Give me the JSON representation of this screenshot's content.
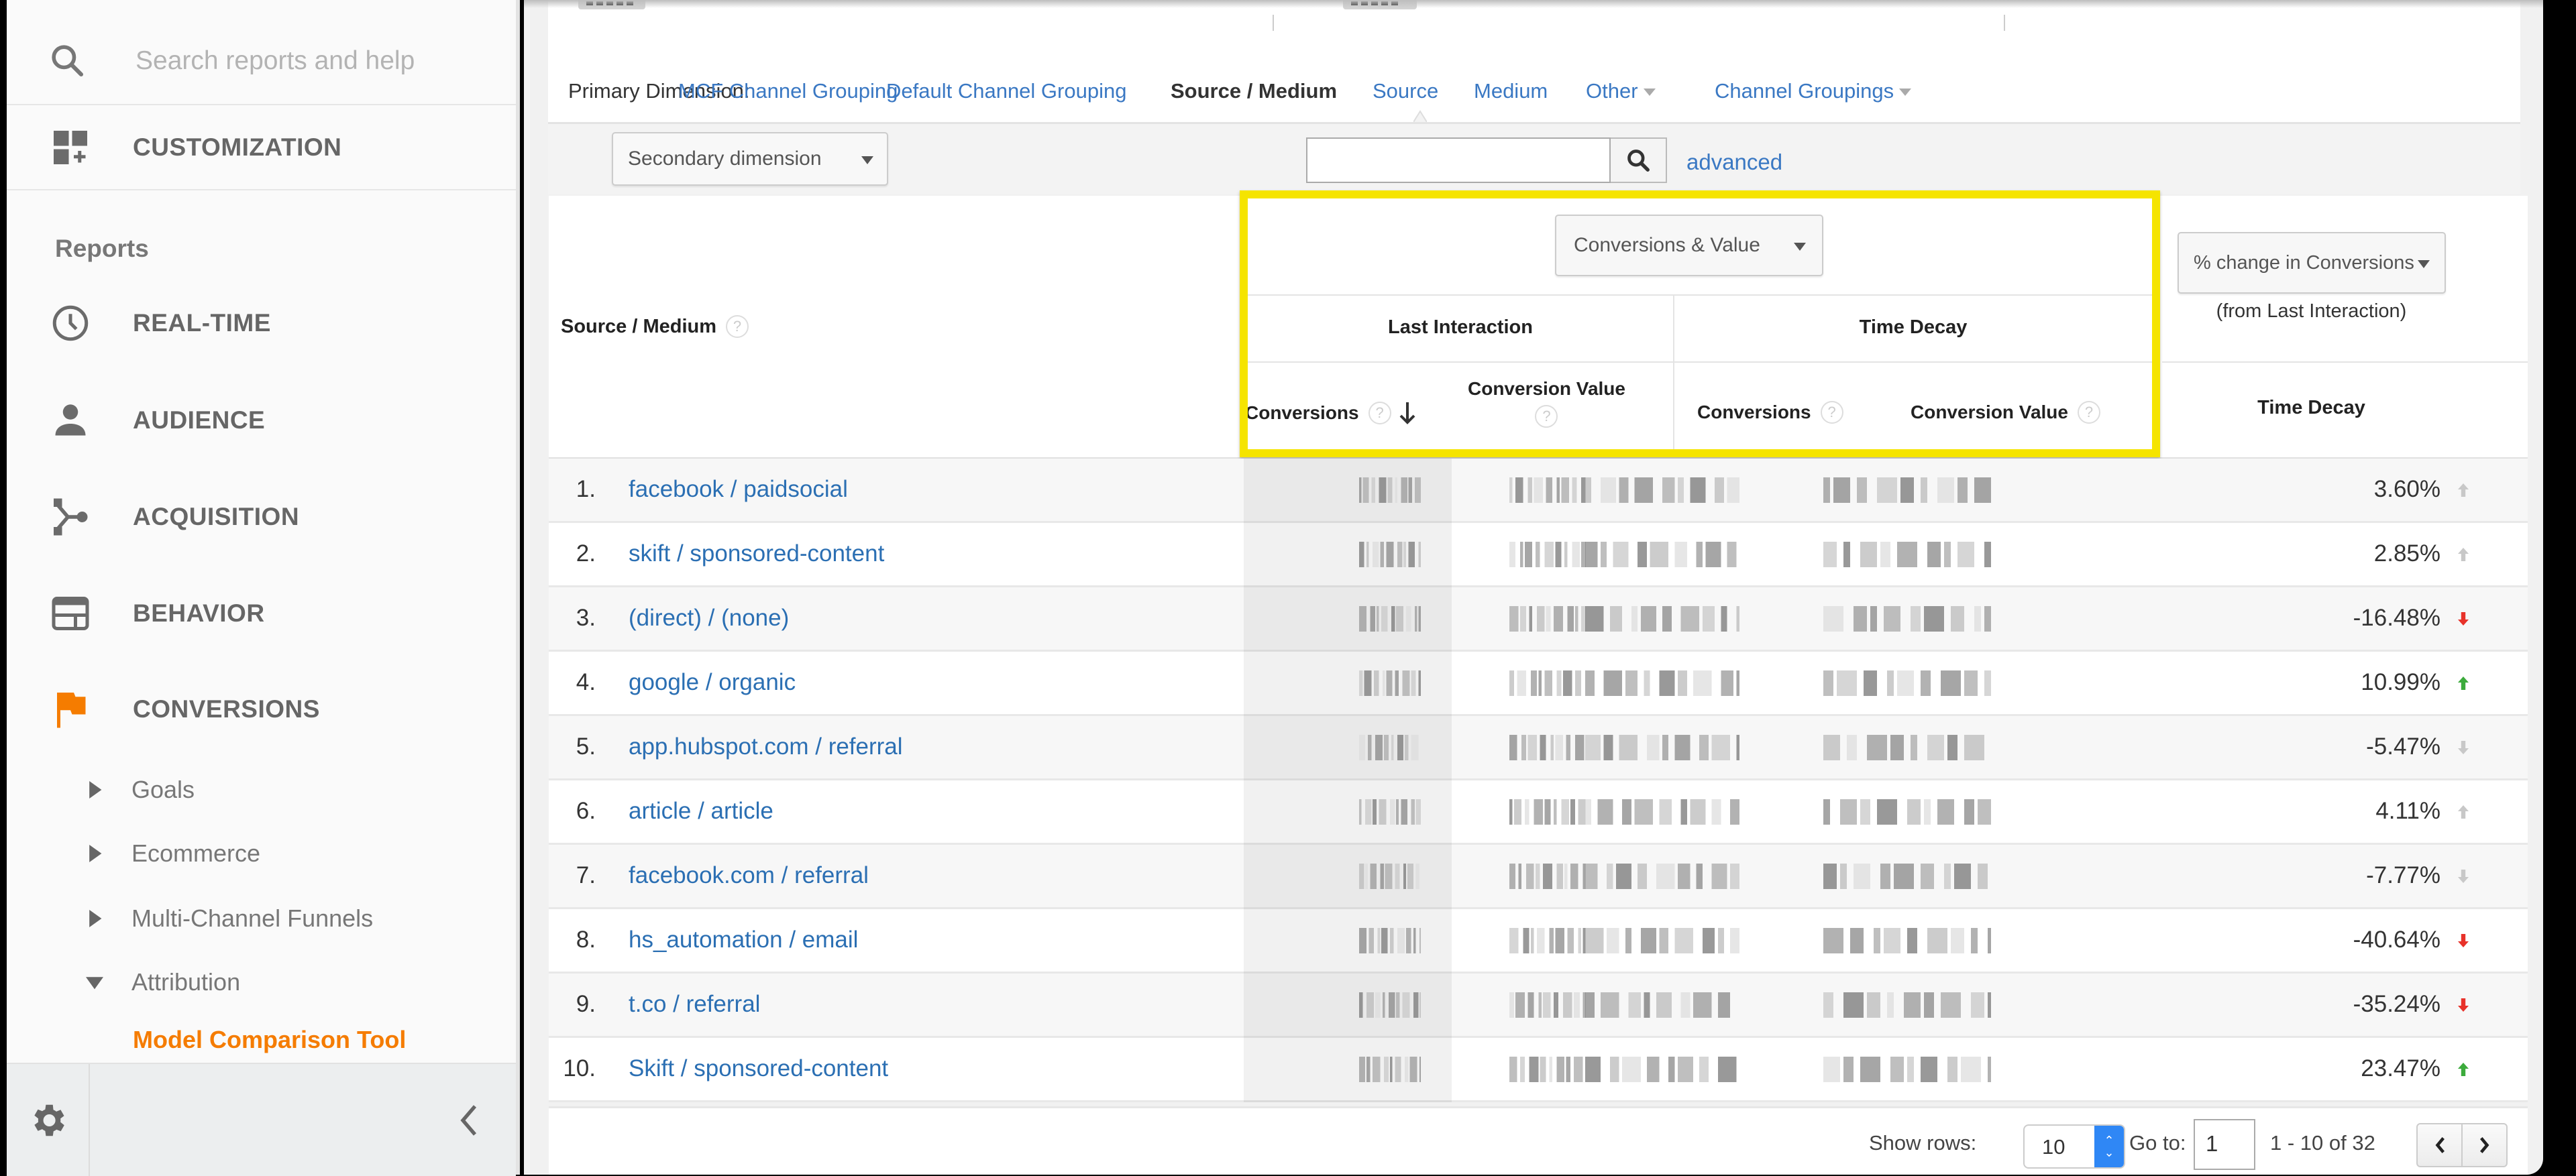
{
  "sidebar": {
    "search_placeholder": "Search reports and help",
    "customization_label": "CUSTOMIZATION",
    "reports_heading": "Reports",
    "nav_items": [
      {
        "label": "REAL-TIME",
        "icon": "clock-icon"
      },
      {
        "label": "AUDIENCE",
        "icon": "person-icon"
      },
      {
        "label": "ACQUISITION",
        "icon": "acquisition-icon"
      },
      {
        "label": "BEHAVIOR",
        "icon": "behavior-icon"
      },
      {
        "label": "CONVERSIONS",
        "icon": "flag-icon",
        "accent": "#f57c00"
      }
    ],
    "sub_items": [
      {
        "label": "Goals",
        "expanded": false
      },
      {
        "label": "Ecommerce",
        "expanded": false
      },
      {
        "label": "Multi-Channel Funnels",
        "expanded": false
      },
      {
        "label": "Attribution",
        "expanded": true
      }
    ],
    "active_item": "Model Comparison Tool"
  },
  "dimension_bar": {
    "label": "Primary Dimension:",
    "options": [
      {
        "label": "MCF Channel Grouping",
        "active": false,
        "dropdown": false
      },
      {
        "label": "Default Channel Grouping",
        "active": false,
        "dropdown": false
      },
      {
        "label": "Source / Medium",
        "active": true,
        "dropdown": false
      },
      {
        "label": "Source",
        "active": false,
        "dropdown": false
      },
      {
        "label": "Medium",
        "active": false,
        "dropdown": false
      },
      {
        "label": "Other",
        "active": false,
        "dropdown": true
      },
      {
        "label": "Channel Groupings",
        "active": false,
        "dropdown": true
      }
    ]
  },
  "toolbar": {
    "secondary_dimension": "Secondary dimension",
    "search_value": "",
    "advanced_label": "advanced"
  },
  "table": {
    "dimension_header": "Source / Medium",
    "metric_selector": "Conversions & Value",
    "model_groups": [
      "Last Interaction",
      "Time Decay"
    ],
    "columns": {
      "li_conversions": "Conversions",
      "li_value": "Conversion Value",
      "td_conversions": "Conversions",
      "td_value": "Conversion Value"
    },
    "sorted_column": "li_conversions",
    "sort_direction": "descending",
    "change_selector": "% change in Conversions",
    "change_sub": "(from Last Interaction)",
    "change_model": "Time Decay",
    "highlight_color": "#f5e400",
    "redacted_note": "numeric cells are pixelated",
    "rows": [
      {
        "num": "1.",
        "source": "facebook / paidsocial",
        "change": "3.60%",
        "trend": "up-neutral"
      },
      {
        "num": "2.",
        "source": "skift / sponsored-content",
        "change": "2.85%",
        "trend": "up-neutral"
      },
      {
        "num": "3.",
        "source": "(direct) / (none)",
        "change": "-16.48%",
        "trend": "down-bad"
      },
      {
        "num": "4.",
        "source": "google / organic",
        "change": "10.99%",
        "trend": "up-good"
      },
      {
        "num": "5.",
        "source": "app.hubspot.com / referral",
        "change": "-5.47%",
        "trend": "down-neutral"
      },
      {
        "num": "6.",
        "source": "article / article",
        "change": "4.11%",
        "trend": "up-neutral"
      },
      {
        "num": "7.",
        "source": "facebook.com / referral",
        "change": "-7.77%",
        "trend": "down-neutral"
      },
      {
        "num": "8.",
        "source": "hs_automation / email",
        "change": "-40.64%",
        "trend": "down-bad"
      },
      {
        "num": "9.",
        "source": "t.co / referral",
        "change": "-35.24%",
        "trend": "down-bad"
      },
      {
        "num": "10.",
        "source": "Skift / sponsored-content",
        "change": "23.47%",
        "trend": "up-good"
      }
    ],
    "trend_colors": {
      "up-good": "#3cab3c",
      "down-bad": "#e8322a",
      "up-neutral": "#c8c8c8",
      "down-neutral": "#c8c8c8"
    }
  },
  "footer": {
    "show_rows_label": "Show rows:",
    "show_rows_value": "10",
    "goto_label": "Go to:",
    "goto_value": "1",
    "range_text": "1 - 10 of 32"
  }
}
